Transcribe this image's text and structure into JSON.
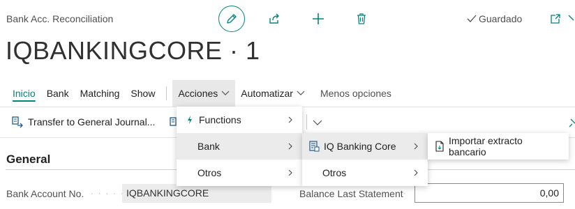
{
  "header": {
    "caption": "Bank Acc. Reconciliation",
    "title": "IQBANKINGCORE · 1",
    "saved_label": "Guardado"
  },
  "menubar": {
    "items": [
      {
        "label": "Inicio"
      },
      {
        "label": "Bank"
      },
      {
        "label": "Matching"
      },
      {
        "label": "Show"
      },
      {
        "label": "Acciones"
      },
      {
        "label": "Automatizar"
      },
      {
        "label": "Menos opciones"
      }
    ]
  },
  "actions": {
    "transfer_label": "Transfer to General Journal..."
  },
  "section": {
    "title": "General"
  },
  "fields": {
    "bank_account_no": {
      "label": "Bank Account No.",
      "value": "IQBANKINGCORE"
    },
    "balance_last_statement": {
      "label": "Balance Last Statement",
      "value": "0,00"
    }
  },
  "menus": {
    "acciones": [
      {
        "label": "Functions"
      },
      {
        "label": "Bank"
      },
      {
        "label": "Otros"
      }
    ],
    "bank": [
      {
        "label": "IQ Banking Core"
      },
      {
        "label": "Otros"
      }
    ],
    "iq_banking_core": [
      {
        "label": "Importar extracto bancario"
      }
    ]
  },
  "colors": {
    "accent": "#00857a",
    "highlight": "#ebebeb"
  }
}
